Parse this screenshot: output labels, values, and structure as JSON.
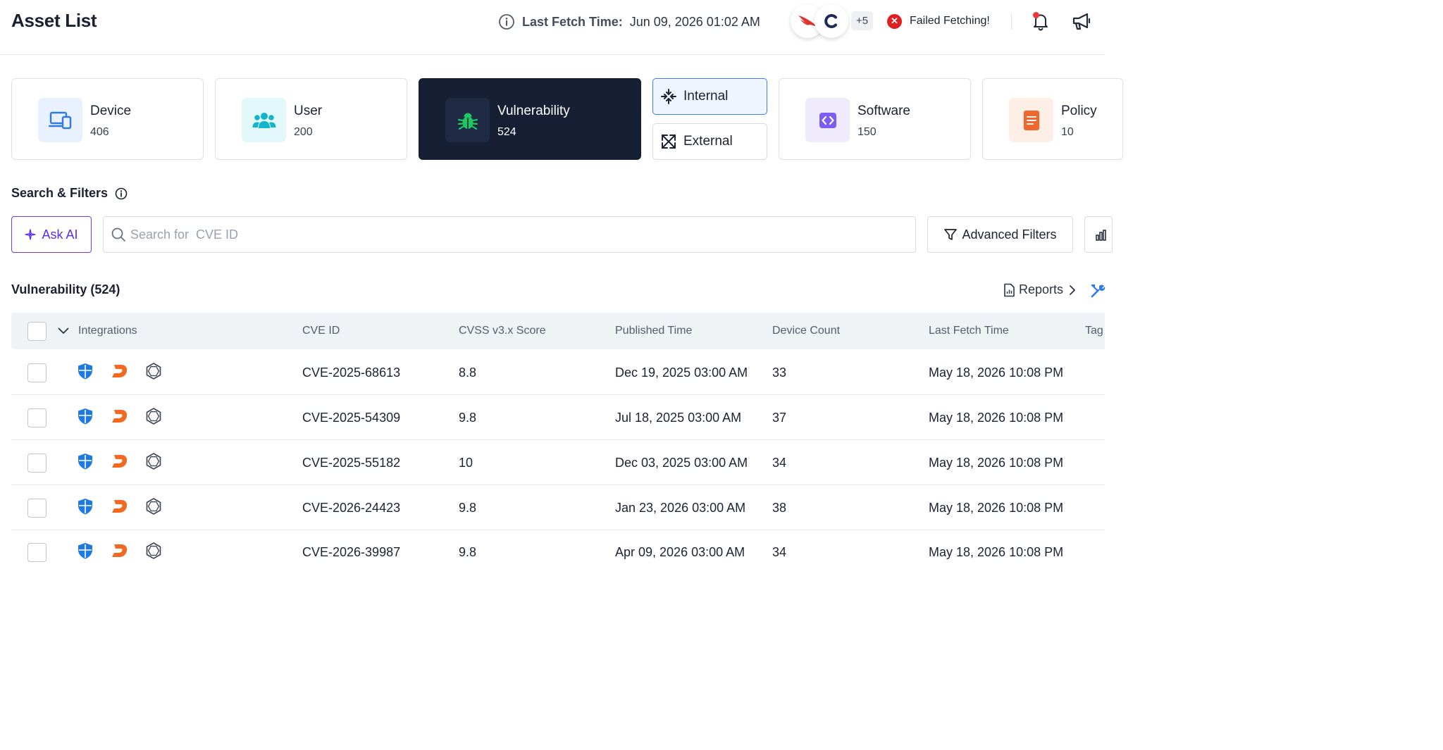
{
  "header": {
    "title": "Asset List",
    "last_fetch_label": "Last Fetch Time:",
    "last_fetch_value": "Jun 09, 2026 01:02 AM",
    "more_integrations": "+5",
    "fetch_status": "Failed Fetching!",
    "status_color": "#e02020"
  },
  "categories": [
    {
      "label": "Device",
      "count": "406",
      "icon": "device-icon",
      "color": "#2f7ae5"
    },
    {
      "label": "User",
      "count": "200",
      "icon": "users-icon",
      "color": "#12b5c9"
    },
    {
      "label": "Vulnerability",
      "count": "524",
      "icon": "bug-icon",
      "color": "#22c55e",
      "active": true
    },
    {
      "label": "Software",
      "count": "150",
      "icon": "code-icon",
      "color": "#7c5cf6"
    },
    {
      "label": "Policy",
      "count": "10",
      "icon": "document-icon",
      "color": "#f0662d"
    }
  ],
  "scope_tabs": [
    {
      "label": "Internal",
      "icon": "collapse-arrows-icon",
      "selected": true
    },
    {
      "label": "External",
      "icon": "expand-arrows-icon",
      "selected": false
    }
  ],
  "search": {
    "title": "Search & Filters",
    "ask_ai_label": "Ask AI",
    "placeholder": "Search for  CVE ID",
    "value": "",
    "advanced_filters_label": "Advanced Filters"
  },
  "table": {
    "title": "Vulnerability (524)",
    "reports_label": "Reports",
    "columns": [
      "Integrations",
      "CVE ID",
      "CVSS v3.x Score",
      "Published Time",
      "Device Count",
      "Last Fetch Time",
      "Tag"
    ],
    "rows": [
      {
        "integrations": [
          "shield-icon",
          "orange-d-logo-icon",
          "hexagon-logo-icon"
        ],
        "cve_id": "CVE-2025-68613",
        "cvss": "8.8",
        "published": "Dec 19, 2025 03:00 AM",
        "device_count": "33",
        "last_fetch": "May 18, 2026 10:08 PM"
      },
      {
        "integrations": [
          "shield-icon",
          "orange-d-logo-icon",
          "hexagon-logo-icon"
        ],
        "cve_id": "CVE-2025-54309",
        "cvss": "9.8",
        "published": "Jul 18, 2025 03:00 AM",
        "device_count": "37",
        "last_fetch": "May 18, 2026 10:08 PM"
      },
      {
        "integrations": [
          "shield-icon",
          "orange-d-logo-icon",
          "hexagon-logo-icon"
        ],
        "cve_id": "CVE-2025-55182",
        "cvss": "10",
        "published": "Dec 03, 2025 03:00 AM",
        "device_count": "34",
        "last_fetch": "May 18, 2026 10:08 PM"
      },
      {
        "integrations": [
          "shield-icon",
          "orange-d-logo-icon",
          "hexagon-logo-icon"
        ],
        "cve_id": "CVE-2026-24423",
        "cvss": "9.8",
        "published": "Jan 23, 2026 03:00 AM",
        "device_count": "38",
        "last_fetch": "May 18, 2026 10:08 PM"
      },
      {
        "integrations": [
          "shield-icon",
          "orange-d-logo-icon",
          "hexagon-logo-icon"
        ],
        "cve_id": "CVE-2026-39987",
        "cvss": "9.8",
        "published": "Apr 09, 2026 03:00 AM",
        "device_count": "34",
        "last_fetch": "May 18, 2026 10:08 PM"
      }
    ]
  },
  "colors": {
    "accent_ai": "#5b2ee8",
    "selected_tab_border": "#3e7cf2",
    "active_card_bg": "#161f33"
  }
}
